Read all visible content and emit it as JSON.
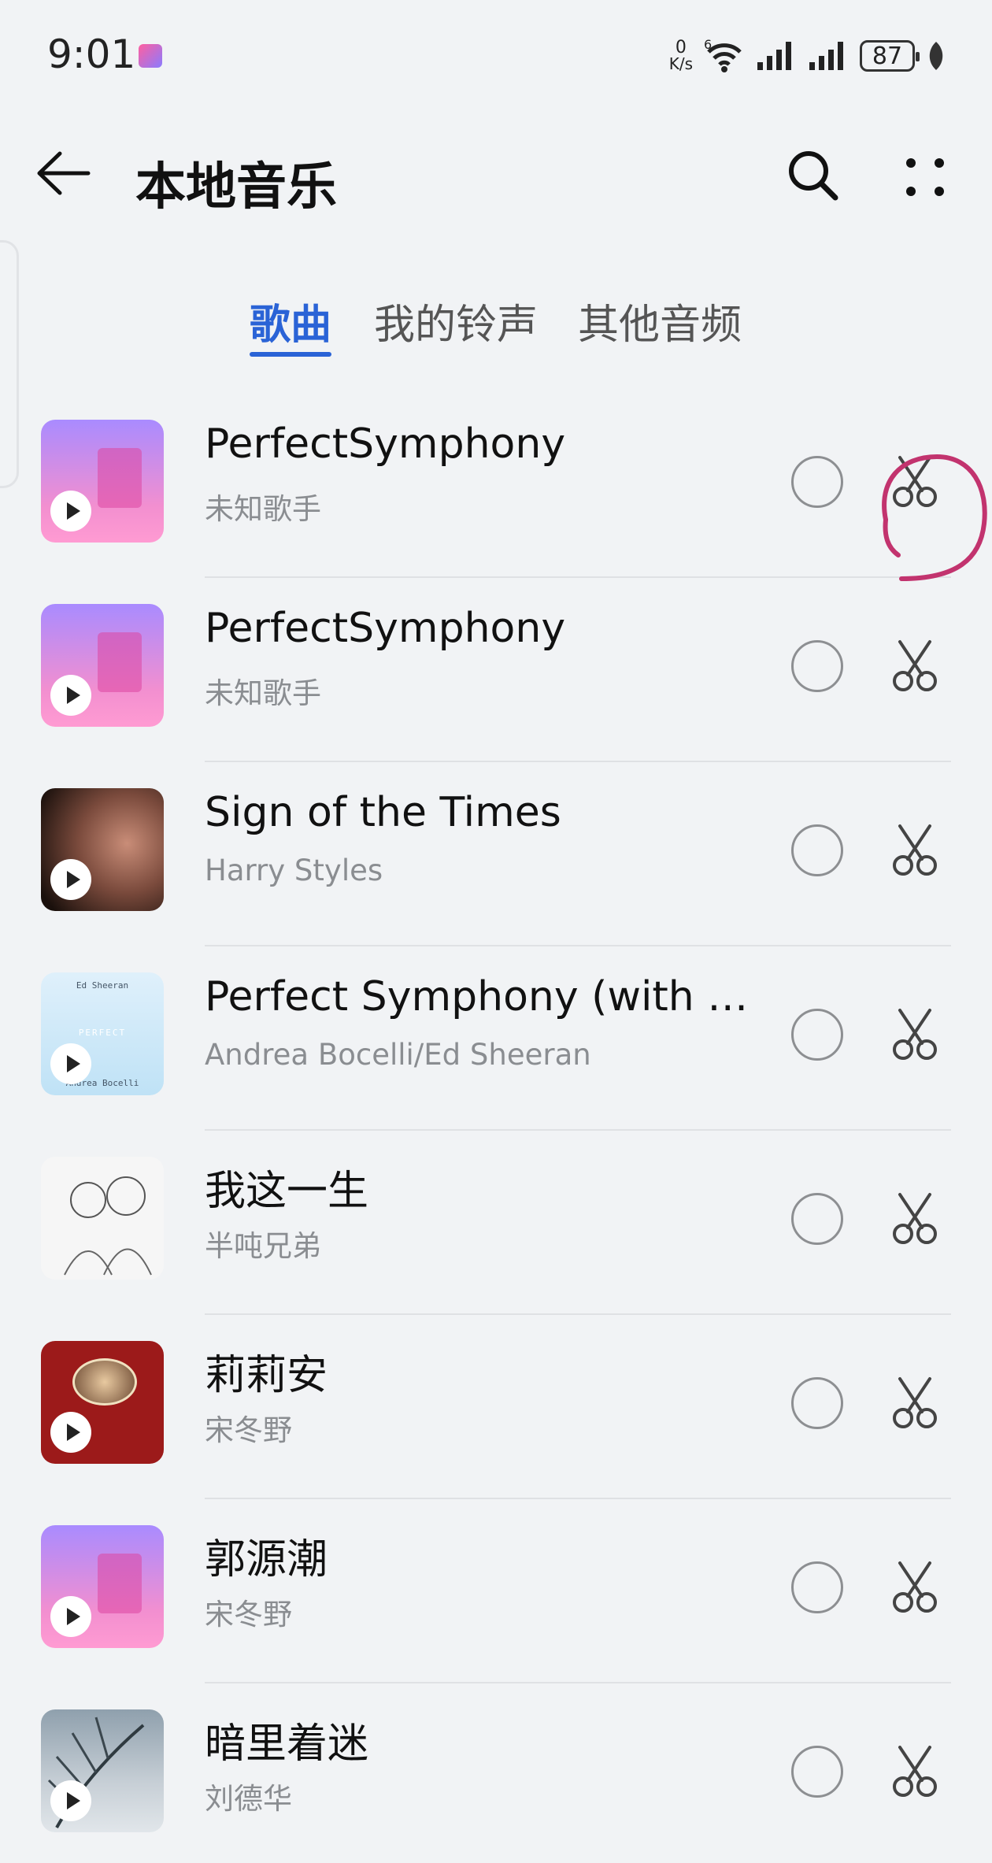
{
  "status_bar": {
    "time": "9:01",
    "net_speed_value": "0",
    "net_speed_unit": "K/s",
    "signal_label": "6",
    "battery": "87"
  },
  "header": {
    "title": "本地音乐",
    "icons": {
      "back": "arrow-left-icon",
      "search": "search-icon",
      "more": "more-dots-icon"
    }
  },
  "tabs": [
    {
      "label": "歌曲",
      "active": true
    },
    {
      "label": "我的铃声",
      "active": false
    },
    {
      "label": "其他音频",
      "active": false
    }
  ],
  "songs": [
    {
      "title": "PerfectSymphony",
      "artist": "未知歌手",
      "cover": "default-music"
    },
    {
      "title": "PerfectSymphony",
      "artist": "未知歌手",
      "cover": "default-music"
    },
    {
      "title": "Sign of the Times",
      "artist": "Harry Styles",
      "cover": "album-photo"
    },
    {
      "title": "Perfect Symphony (with An…",
      "artist": "Andrea Bocelli/Ed Sheeran",
      "cover": "album-ed-sheeran"
    },
    {
      "title": "我这一生",
      "artist": "半吨兄弟",
      "cover": "album-sketch"
    },
    {
      "title": "莉莉安",
      "artist": "宋冬野",
      "cover": "album-red"
    },
    {
      "title": "郭源潮",
      "artist": "宋冬野",
      "cover": "default-music"
    },
    {
      "title": "暗里着迷",
      "artist": "刘德华",
      "cover": "album-andy"
    }
  ],
  "ed_cover_text": {
    "top": "Ed Sheeran",
    "middle": "PERFECT",
    "bottom": "Andrea Bocelli"
  },
  "colors": {
    "accent": "#2a63d6",
    "annotation": "#c2336e"
  }
}
